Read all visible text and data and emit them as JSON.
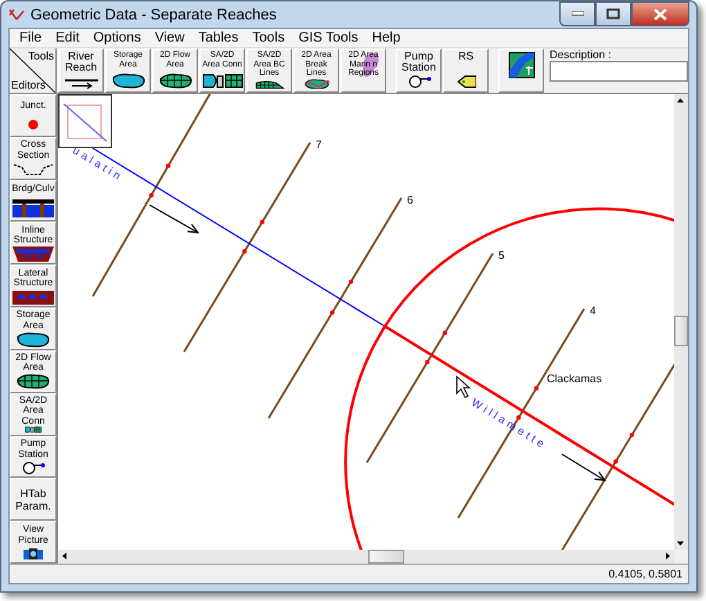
{
  "window": {
    "title": "Geometric Data - Separate Reaches"
  },
  "menu": [
    "File",
    "Edit",
    "Options",
    "View",
    "Tables",
    "Tools",
    "GIS Tools",
    "Help"
  ],
  "toolbar": {
    "corner": {
      "top": "Tools",
      "bottom": "Editors"
    },
    "tools": [
      {
        "kind": "reach",
        "label": "River Reach"
      },
      {
        "kind": "storage",
        "label": "Storage Area"
      },
      {
        "kind": "flow2d",
        "label": "2D Flow Area"
      },
      {
        "kind": "conn",
        "label": "SA/2D Area Conn"
      },
      {
        "kind": "bclines",
        "label": "SA/2D Area BC Lines"
      },
      {
        "kind": "breaklines",
        "label": "2D Area Break Lines"
      },
      {
        "kind": "mann",
        "label": "2D Area Mann n Regions"
      },
      {
        "kind": "pump",
        "label": "Pump Station"
      },
      {
        "kind": "rs",
        "label": "RS"
      },
      {
        "kind": "gis"
      }
    ],
    "description": {
      "label": "Description :"
    }
  },
  "editors": [
    {
      "kind": "junction",
      "label": "Junct."
    },
    {
      "kind": "xs",
      "label": "Cross Section"
    },
    {
      "kind": "bridge",
      "label": "Brdg/Culv"
    },
    {
      "kind": "inline",
      "label": "Inline Structure"
    },
    {
      "kind": "lateral",
      "label": "Lateral Structure"
    },
    {
      "kind": "storage",
      "label": "Storage Area"
    },
    {
      "kind": "flow2d",
      "label": "2D Flow Area"
    },
    {
      "kind": "conn",
      "label": "SA/2D Area Conn"
    },
    {
      "kind": "pump",
      "label": "Pump Station"
    },
    {
      "kind": "none",
      "label": "HTab Param."
    },
    {
      "kind": "picture",
      "label": "View Picture"
    }
  ],
  "canvas": {
    "reaches": [
      {
        "name": "ualatin",
        "color": "#0000ff"
      },
      {
        "name": "Willamette",
        "color": "#ff0000"
      }
    ],
    "junctions": [
      {
        "name": "Clackamas"
      }
    ],
    "cross_section_labels": [
      "7",
      "6",
      "5",
      "4"
    ]
  },
  "status_bar": {
    "coordinates": "0.4105, 0.5801"
  }
}
